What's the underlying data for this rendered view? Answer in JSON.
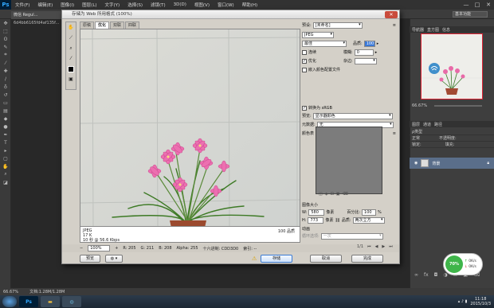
{
  "app": {
    "logo": "Ps"
  },
  "menu": [
    "文件(F)",
    "编辑(E)",
    "图像(I)",
    "图层(L)",
    "文字(Y)",
    "选择(S)",
    "滤镜(T)",
    "3D(D)",
    "视图(V)",
    "窗口(W)",
    "帮助(H)"
  ],
  "window_controls": [
    "—",
    "□",
    "✕"
  ],
  "workspace": "基本功能",
  "doc_tab": "微信 Regul...",
  "doc_tab2": "6d4bb6165fd4af135f...",
  "status_bar": {
    "zoom": "66.67%",
    "doc": "文档:1.28M/1.28M"
  },
  "dialog": {
    "title": "存储为 Web 所用格式 (100%)",
    "close": "✕",
    "tabs": [
      "原稿",
      "优化",
      "双联",
      "四联"
    ],
    "active_tab": 1,
    "image_info": {
      "format": "JPEG",
      "size": "17 K",
      "speed": "10 秒 @ 56.6 Kbps",
      "quality": "100 品质"
    },
    "bottom": {
      "zoom": "100%",
      "r": "R: 205",
      "g": "G: 211",
      "b": "B: 208",
      "alpha": "Alpha: 255",
      "hex": "十六进制: CDD3D0",
      "index": "索引: --"
    },
    "buttons": {
      "preview": "预览",
      "save": "存储",
      "cancel": "取消",
      "done": "完成"
    },
    "settings": {
      "preset_label": "预设:",
      "preset_value": "[未命名]",
      "format": "JPEG",
      "quality_mode": "最佳",
      "quality_label": "品质:",
      "quality_value": "100",
      "progressive": "连续",
      "blur_label": "模糊:",
      "blur_value": "0",
      "optimized": "优化",
      "matte_label": "杂边:",
      "embed_profile": "嵌入颜色配置文件",
      "convert_srgb": "转换为 sRGB",
      "preview_label": "预览:",
      "preview_value": "显示器颜色",
      "metadata_label": "元数据:",
      "metadata_value": "无",
      "color_table": "颜色表",
      "image_size": "图像大小",
      "w_label": "W:",
      "w_value": "580",
      "h_label": "H:",
      "h_value": "773",
      "pixel": "像素",
      "percent_label": "百分比:",
      "percent_value": "100",
      "percent_unit": "%",
      "quality2_label": "品质:",
      "quality2_value": "两次立方",
      "anim": "动画",
      "loop_label": "循环选项:",
      "loop_value": "一次",
      "frame": "1/1"
    }
  },
  "right_panel": {
    "nav_tabs": [
      "导航器",
      "直方图",
      "信息"
    ],
    "zoom": "66.67%",
    "layer_tabs": [
      "图层",
      "通道",
      "路径"
    ],
    "layer_rows": [
      "ρ类型",
      "正常",
      "锁定:"
    ],
    "layer_row_right": [
      "不透明度:",
      "填充:"
    ],
    "layer_name": "背景"
  },
  "net_widget": {
    "percent": "70%",
    "up": "0K/s",
    "down": "0K/s"
  },
  "taskbar": {
    "time": "11:18",
    "date": "2015/10/3"
  },
  "colors": {
    "ps_blue": "#31a8ff",
    "dialog_bg": "#d4d0c8",
    "layer_sel": "#5a6e8a"
  }
}
